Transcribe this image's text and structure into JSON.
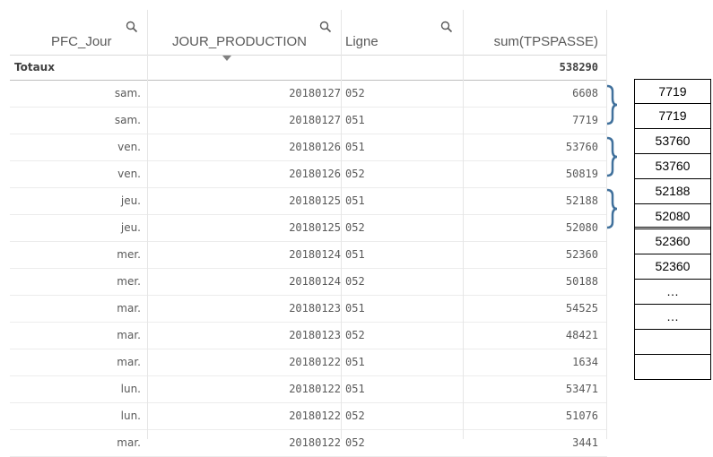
{
  "table": {
    "columns": [
      {
        "label": "PFC_Jour",
        "searchable": true
      },
      {
        "label": "JOUR_PRODUCTION",
        "searchable": true
      },
      {
        "label": "Ligne",
        "searchable": true
      },
      {
        "label": "sum(TPSPASSE)",
        "searchable": false
      }
    ],
    "totals": {
      "label": "Totaux",
      "value": "538290"
    },
    "rows": [
      {
        "day": "sam.",
        "date": "20180127",
        "line": "052",
        "value": "6608"
      },
      {
        "day": "sam.",
        "date": "20180127",
        "line": "051",
        "value": "7719"
      },
      {
        "day": "ven.",
        "date": "20180126",
        "line": "051",
        "value": "53760"
      },
      {
        "day": "ven.",
        "date": "20180126",
        "line": "052",
        "value": "50819"
      },
      {
        "day": "jeu.",
        "date": "20180125",
        "line": "051",
        "value": "52188"
      },
      {
        "day": "jeu.",
        "date": "20180125",
        "line": "052",
        "value": "52080"
      },
      {
        "day": "mer.",
        "date": "20180124",
        "line": "051",
        "value": "52360"
      },
      {
        "day": "mer.",
        "date": "20180124",
        "line": "052",
        "value": "50188"
      },
      {
        "day": "mar.",
        "date": "20180123",
        "line": "051",
        "value": "54525"
      },
      {
        "day": "mar.",
        "date": "20180123",
        "line": "052",
        "value": "48421"
      },
      {
        "day": "mar.",
        "date": "20180122",
        "line": "051",
        "value": "1634"
      },
      {
        "day": "lun.",
        "date": "20180122",
        "line": "051",
        "value": "53471"
      },
      {
        "day": "lun.",
        "date": "20180122",
        "line": "052",
        "value": "51076"
      },
      {
        "day": "mar.",
        "date": "20180122",
        "line": "052",
        "value": "3441"
      }
    ]
  },
  "side_values": [
    "7719",
    "7719",
    "53760",
    "53760",
    "52188",
    "52080",
    "52360",
    "52360",
    "…",
    "…",
    "",
    ""
  ],
  "colors": {
    "bracket": "#41719c",
    "grid": "#e6e6e6",
    "text": "#595959"
  },
  "icons": {
    "column_search": "magnifier-icon",
    "sort": "sort-descending-triangle-icon",
    "group": "right-curly-bracket"
  }
}
